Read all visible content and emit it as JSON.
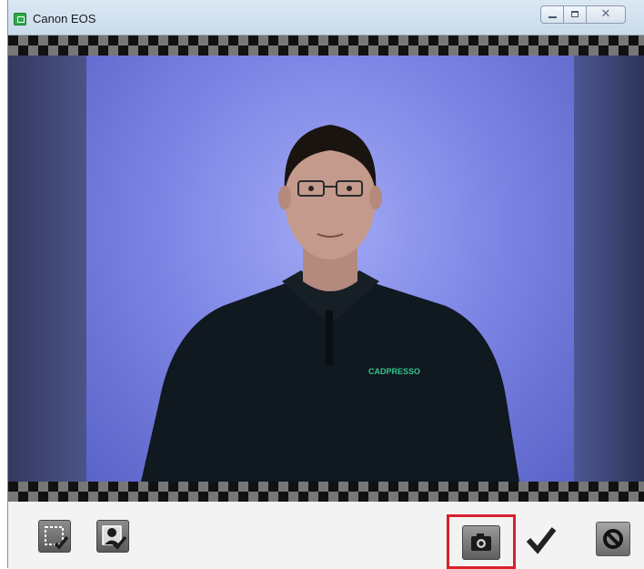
{
  "window": {
    "title": "Canon EOS",
    "title_icon": "app-icon",
    "controls": [
      {
        "name": "minimize",
        "icon": "minimize-icon"
      },
      {
        "name": "maximize",
        "icon": "maximize-icon"
      },
      {
        "name": "close",
        "icon": "close-icon",
        "glyph": "✕"
      }
    ]
  },
  "preview": {
    "subject": "live-view-person",
    "shirt_logo": "CADPRESSO",
    "background_color": "#7f88e6"
  },
  "toolbar": {
    "buttons": [
      {
        "name": "select-area-button",
        "icon": "crop-check-icon"
      },
      {
        "name": "select-face-button",
        "icon": "portrait-check-icon"
      },
      {
        "name": "capture-button",
        "icon": "camera-icon",
        "highlighted": true,
        "highlight_color": "#d7202e"
      },
      {
        "name": "accept-button",
        "icon": "checkmark-icon"
      },
      {
        "name": "cancel-button",
        "icon": "cancel-icon"
      }
    ]
  }
}
